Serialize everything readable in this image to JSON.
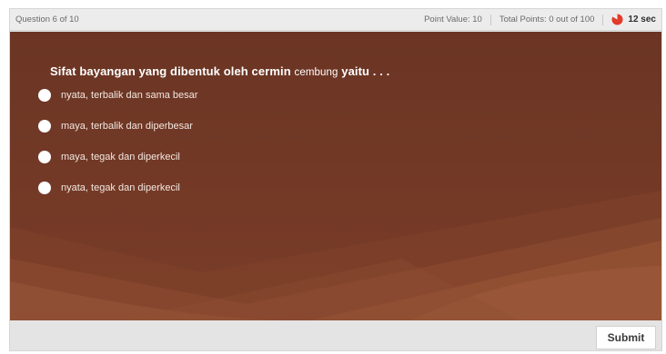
{
  "header": {
    "question_counter": "Question 6 of 10",
    "point_value": "Point Value: 10",
    "total_points": "Total Points: 0 out of 100",
    "timer_text": "12 sec",
    "timer_icon": "pie-timer-icon",
    "timer_color": "#e23b2b"
  },
  "question": {
    "part1": "Sifat bayangan yang dibentuk oleh cermin",
    "part2": "cembung",
    "part3": "yaitu . . ."
  },
  "options": [
    {
      "label": "nyata, terbalik dan sama besar",
      "selected": false
    },
    {
      "label": "maya, terbalik dan diperbesar",
      "selected": false
    },
    {
      "label": "maya, tegak dan diperkecil",
      "selected": false
    },
    {
      "label": "nyata, tegak dan diperkecil",
      "selected": false
    }
  ],
  "footer": {
    "submit_label": "Submit"
  },
  "colors": {
    "stage_background": "#6a3424",
    "radio": "#ffffff"
  }
}
